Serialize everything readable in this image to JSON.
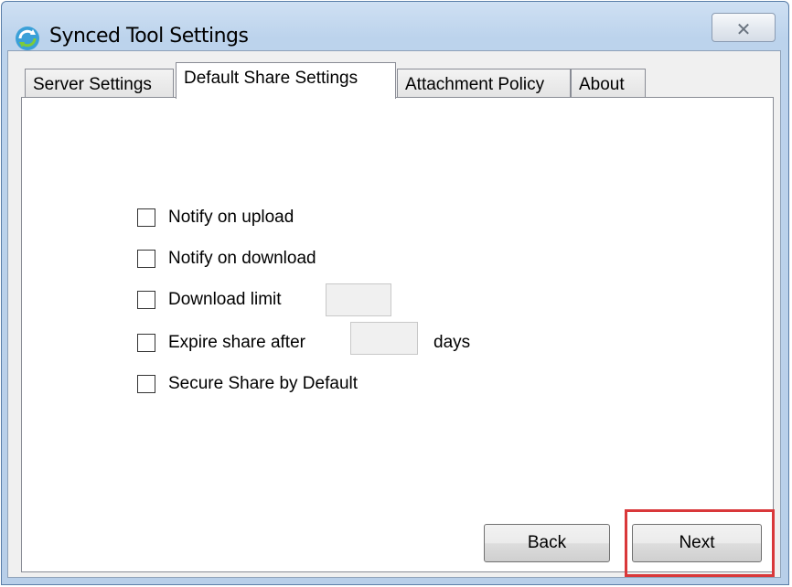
{
  "window": {
    "title": "Synced Tool Settings",
    "close_label": "✕"
  },
  "tabs": [
    {
      "label": "Server Settings",
      "active": false
    },
    {
      "label": "Default Share Settings",
      "active": true
    },
    {
      "label": "Attachment Policy",
      "active": false
    },
    {
      "label": "About",
      "active": false
    }
  ],
  "options": {
    "notify_upload": {
      "label": "Notify on upload",
      "checked": false
    },
    "notify_download": {
      "label": "Notify on download",
      "checked": false
    },
    "download_limit": {
      "label": "Download limit",
      "checked": false,
      "value": ""
    },
    "expire_share": {
      "label": "Expire share after",
      "checked": false,
      "value": "",
      "unit": "days"
    },
    "secure_share": {
      "label": "Secure Share by Default",
      "checked": false
    }
  },
  "buttons": {
    "back": "Back",
    "next": "Next"
  },
  "colors": {
    "highlight": "#d9383a",
    "accent": "#3a8fd9"
  }
}
